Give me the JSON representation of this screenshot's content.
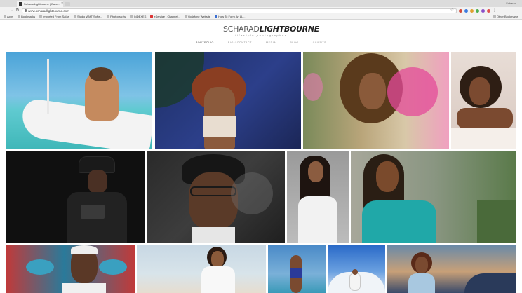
{
  "browser": {
    "tab_title": "ScharadLightbourne | Bahar...",
    "tab_close": "×",
    "user_label": "Scharad",
    "url": "www.scharadlightbourne.com",
    "back_glyph": "←",
    "forward_glyph": "→",
    "reload_glyph": "↻",
    "star_glyph": "☆",
    "menu_glyph": "⋮"
  },
  "bookmarks": {
    "items": [
      {
        "label": "Apps",
        "icon": "apps-icon"
      },
      {
        "label": "Bookmarks",
        "icon": "folder-icon"
      },
      {
        "label": "Imported From Safari",
        "icon": "folder-icon"
      },
      {
        "label": "Studio WMT Softw...",
        "icon": "folder-icon"
      },
      {
        "label": "Photography",
        "icon": "folder-icon"
      },
      {
        "label": "INDEXES",
        "icon": "folder-icon"
      },
      {
        "label": "eService - Channel...",
        "icon": "red-icon"
      },
      {
        "label": "Vodafone Website",
        "icon": "folder-icon"
      },
      {
        "label": "How To Form An LL...",
        "icon": "blue-icon"
      }
    ],
    "other": "Other Bookmarks"
  },
  "site": {
    "logo_part1": "SCHARAD",
    "logo_part2": "LIGHTBOURNE",
    "tagline": "lifestyle photographer",
    "nav": [
      "PORTFOLIO",
      "BIO / CONTACT",
      "MEDIA",
      "BLOG",
      "CLIENTS"
    ]
  },
  "colors": {
    "accent": "#333333",
    "nav_muted": "#888888"
  }
}
